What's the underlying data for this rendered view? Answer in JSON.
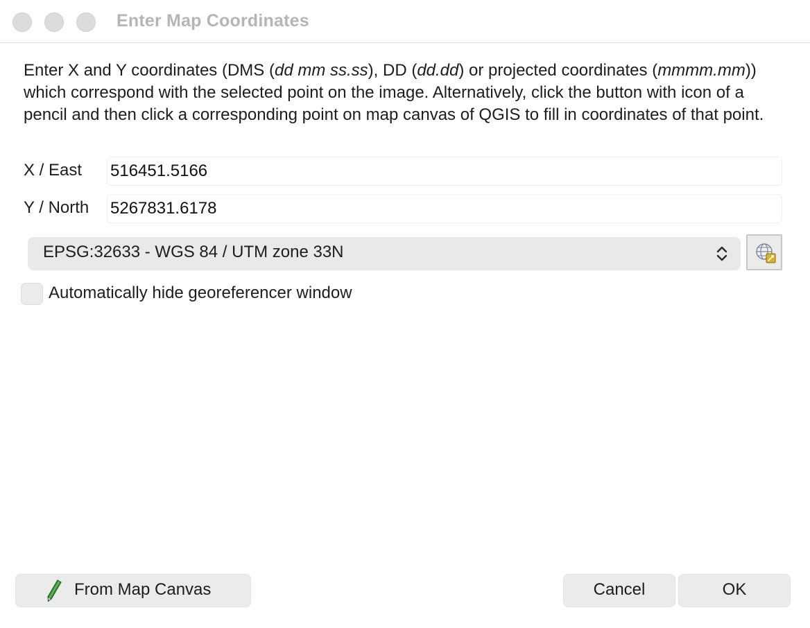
{
  "window": {
    "title": "Enter Map Coordinates"
  },
  "description": {
    "p1": "Enter X and Y coordinates (DMS (",
    "i1": "dd mm ss.ss",
    "p2": "), DD (",
    "i2": "dd.dd",
    "p3": ") or projected coordinates (",
    "i3": "mmmm.mm",
    "p4": ")) which correspond with the selected point on the image. Alternatively, click the button with icon of a pencil and then click a corresponding point on map canvas of QGIS to fill in coordinates of that point."
  },
  "fields": {
    "x_label": "X / East",
    "x_value": "516451.5166",
    "y_label": "Y / North",
    "y_value": "5267831.6178"
  },
  "crs": {
    "selected": "EPSG:32633 - WGS 84 / UTM zone 33N"
  },
  "options": {
    "auto_hide_label": "Automatically hide georeferencer window",
    "auto_hide_checked": false
  },
  "buttons": {
    "from_canvas": "From Map Canvas",
    "cancel": "Cancel",
    "ok": "OK"
  },
  "icons": {
    "pencil": "pencil-icon",
    "globe": "crs-selector-globe-icon",
    "updown": "chevron-updown-icon"
  },
  "colors": {
    "pencil_green": "#3d9a3a",
    "globe_accent": "#d8b322"
  }
}
